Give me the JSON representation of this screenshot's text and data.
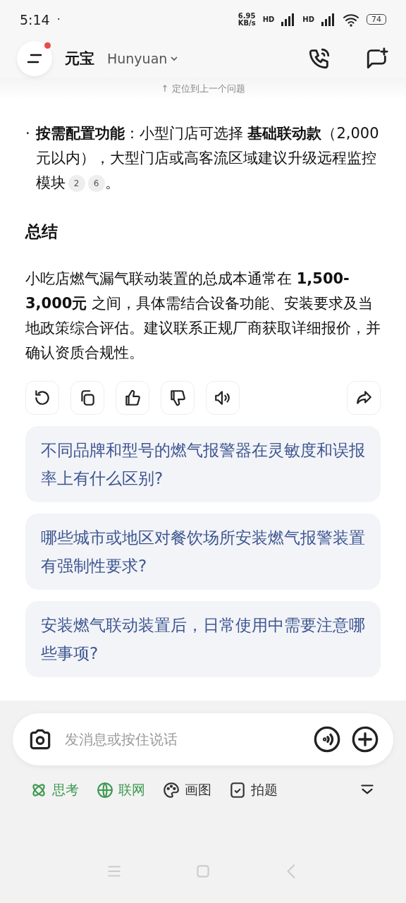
{
  "status_bar": {
    "time": "5:14",
    "dot": "·",
    "speed_value": "6.95",
    "speed_unit": "KB/s",
    "sim_labels": [
      "HD",
      "HD"
    ],
    "battery": "74"
  },
  "header": {
    "title": "元宝",
    "model": "Hunyuan",
    "has_notification": true
  },
  "scroll_hint": "↑ 定位到上一个问题",
  "answer": {
    "bullets": [
      {
        "marker": "·",
        "text": "**按需配置功能**：小型门店可选择 **基础联动款**（2,000元以内），大型门店或高客流区域建议升级远程监控模块",
        "citations": [
          "2",
          "6"
        ],
        "tail": "。"
      }
    ],
    "heading": "总结",
    "paragraph": "小吃店燃气漏气联动装置的总成本通常在 **1,500-3,000元** 之间，具体需结合设备功能、安装要求及当地政策综合评估。建议联系正规厂商获取详细报价，并确认资质合规性。"
  },
  "actions": [
    {
      "kind": "regenerate"
    },
    {
      "kind": "copy"
    },
    {
      "kind": "like"
    },
    {
      "kind": "dislike"
    },
    {
      "kind": "read-aloud"
    },
    {
      "kind": "share"
    }
  ],
  "suggestions": [
    "不同品牌和型号的燃气报警器在灵敏度和误报率上有什么区别?",
    "哪些城市或地区对餐饮场所安装燃气报警装置有强制性要求?",
    "安装燃气联动装置后，日常使用中需要注意哪些事项?"
  ],
  "composer": {
    "placeholder": "发消息或按住说话"
  },
  "tools": [
    {
      "kind": "think",
      "label": "思考",
      "selected": true
    },
    {
      "kind": "web",
      "label": "联网",
      "selected": true
    },
    {
      "kind": "draw",
      "label": "画图",
      "selected": false
    },
    {
      "kind": "photo",
      "label": "拍题",
      "selected": false
    }
  ]
}
